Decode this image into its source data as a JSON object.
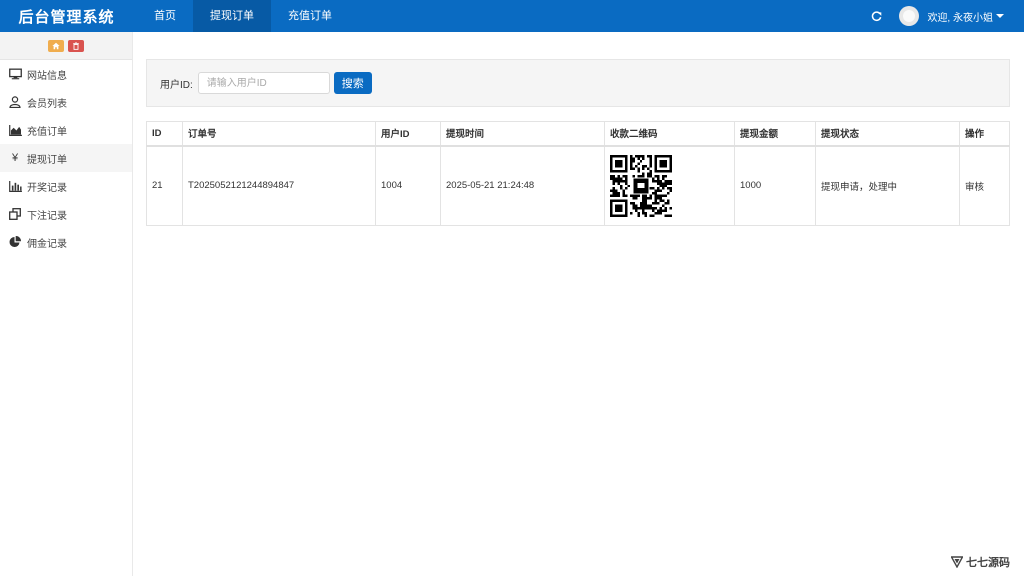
{
  "header": {
    "brand": "后台管理系统",
    "nav": [
      {
        "label": "首页",
        "active": false
      },
      {
        "label": "提现订单",
        "active": true
      },
      {
        "label": "充值订单",
        "active": false
      }
    ],
    "welcome": "欢迎, 永夜小姐",
    "accent": "#0a6bc2"
  },
  "sidebar": {
    "shortcuts": [
      {
        "icon": "home-icon",
        "color": "#f0ad4e"
      },
      {
        "icon": "trash-icon",
        "color": "#d9534f"
      }
    ],
    "items": [
      {
        "label": "网站信息",
        "icon": "monitor-icon"
      },
      {
        "label": "会员列表",
        "icon": "user-icon"
      },
      {
        "label": "充值订单",
        "icon": "area-chart-icon"
      },
      {
        "label": "提现订单",
        "icon": "yen-icon"
      },
      {
        "label": "开奖记录",
        "icon": "bar-chart-icon"
      },
      {
        "label": "下注记录",
        "icon": "clone-icon"
      },
      {
        "label": "佣金记录",
        "icon": "pie-chart-icon"
      }
    ]
  },
  "search": {
    "label": "用户ID:",
    "placeholder": "请输入用户ID",
    "value": "",
    "button": "搜索"
  },
  "table": {
    "headers": [
      "ID",
      "订单号",
      "用户ID",
      "提现时间",
      "收款二维码",
      "提现金额",
      "提现状态",
      "操作"
    ],
    "rows": [
      {
        "id": "21",
        "order_no": "T2025052121244894847",
        "user_id": "1004",
        "time": "2025-05-21 21:24:48",
        "qr": "qr-code-image",
        "amount": "1000",
        "status": "提现申请，处理中",
        "action": "审核"
      }
    ]
  },
  "watermark": {
    "text": "七七源码"
  }
}
